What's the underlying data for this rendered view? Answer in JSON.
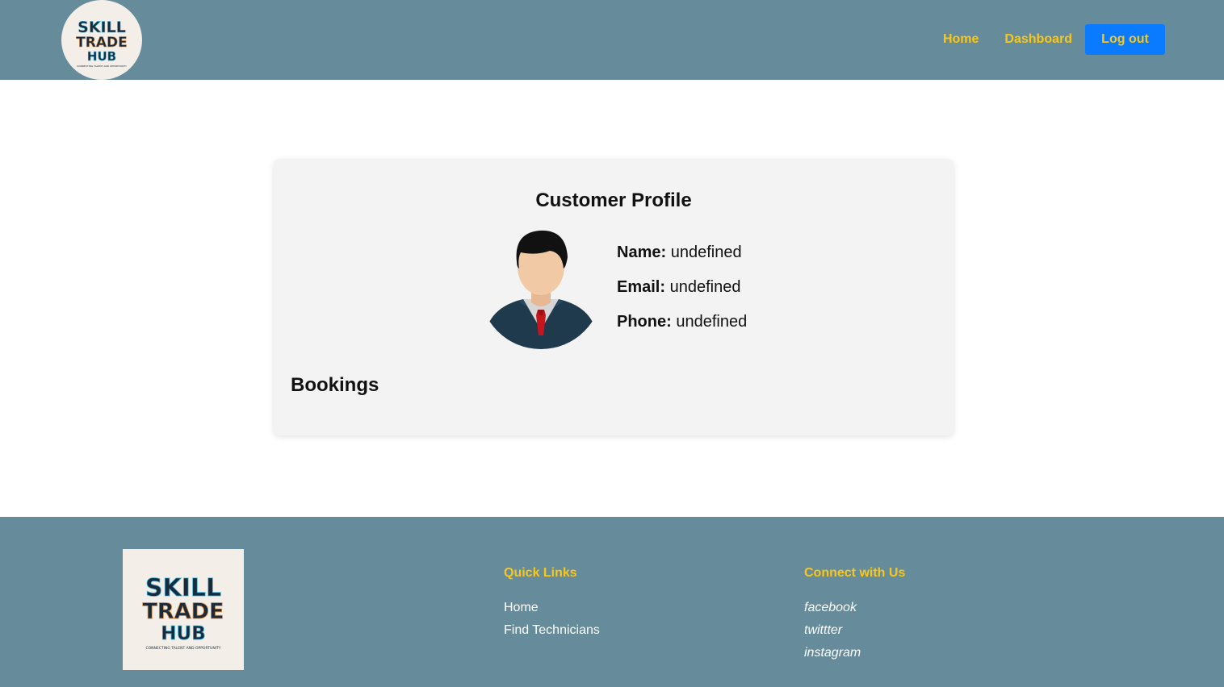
{
  "header": {
    "logo": {
      "line1": "SKILL",
      "line2": "TRADE",
      "line3": "HUB",
      "tagline": "CONNECTING TALENT AND OPPORTUNITY"
    },
    "nav": {
      "home": "Home",
      "dashboard": "Dashboard",
      "logout": "Log out"
    }
  },
  "profile": {
    "title": "Customer Profile",
    "name_label": "Name:",
    "name_value": "undefined",
    "email_label": "Email:",
    "email_value": "undefined",
    "phone_label": "Phone:",
    "phone_value": "undefined",
    "bookings_title": "Bookings"
  },
  "footer": {
    "logo": {
      "line1": "SKILL",
      "line2": "TRADE",
      "line3": "HUB",
      "tagline": "CONNECTING TALENT AND OPPORTUNITY"
    },
    "quick_links": {
      "title": "Quick Links",
      "items": [
        "Home",
        "Find Technicians"
      ]
    },
    "connect": {
      "title": "Connect with Us",
      "items": [
        "facebook",
        "twittter",
        "instagram"
      ]
    }
  },
  "colors": {
    "bar": "#668c9b",
    "accent": "#f7c71c",
    "button": "#0a7bff",
    "card": "#f3f3f3"
  }
}
